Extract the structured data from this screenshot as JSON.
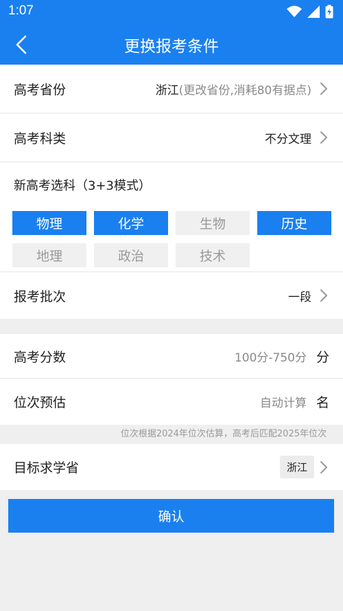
{
  "status_bar": {
    "time": "1:07"
  },
  "nav": {
    "title": "更换报考条件"
  },
  "province": {
    "label": "高考省份",
    "value": "浙江",
    "note": "(更改省份,消耗80有据点)"
  },
  "category": {
    "label": "高考科类",
    "value": "不分文理"
  },
  "subjects": {
    "label": "新高考选科（3+3模式）",
    "items": [
      {
        "label": "物理",
        "selected": true
      },
      {
        "label": "化学",
        "selected": true
      },
      {
        "label": "生物",
        "selected": false
      },
      {
        "label": "历史",
        "selected": true
      },
      {
        "label": "地理",
        "selected": false
      },
      {
        "label": "政治",
        "selected": false
      },
      {
        "label": "技术",
        "selected": false
      }
    ]
  },
  "batch": {
    "label": "报考批次",
    "value": "一段"
  },
  "score": {
    "label": "高考分数",
    "placeholder": "100分-750分",
    "unit": "分"
  },
  "rank": {
    "label": "位次预估",
    "placeholder": "自动计算",
    "unit": "名"
  },
  "rank_hint": "位次根据2024年位次估算，高考后匹配2025年位次",
  "target": {
    "label": "目标求学省",
    "value": "浙江"
  },
  "confirm_label": "确认",
  "colors": {
    "primary": "#1a80f0",
    "chip_off": "#f0f0f0",
    "bg": "#efefef"
  }
}
